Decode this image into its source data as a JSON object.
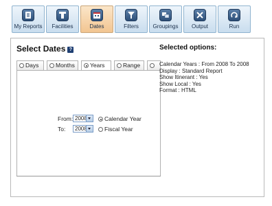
{
  "toolbar": {
    "items": [
      {
        "label": "My Reports",
        "icon": "reports-icon"
      },
      {
        "label": "Facilities",
        "icon": "facilities-icon"
      },
      {
        "label": "Dates",
        "icon": "calendar-icon"
      },
      {
        "label": "Filters",
        "icon": "filter-icon"
      },
      {
        "label": "Groupings",
        "icon": "groupings-icon"
      },
      {
        "label": "Output",
        "icon": "tools-icon"
      },
      {
        "label": "Run",
        "icon": "run-icon"
      }
    ],
    "active": "Dates"
  },
  "panel": {
    "title": "Select Dates",
    "help_icon_text": "?"
  },
  "tabs": [
    {
      "label": "Days",
      "selected": false
    },
    {
      "label": "Months",
      "selected": false
    },
    {
      "label": "Years",
      "selected": true
    },
    {
      "label": "Range",
      "selected": false
    },
    {
      "label": "",
      "selected": false
    }
  ],
  "date_form": {
    "from_label": "From:",
    "to_label": "To:",
    "from_value": "2008",
    "to_value": "2008",
    "calendar_year_label": "Calendar Year",
    "fiscal_year_label": "Fiscal Year",
    "year_type_selected": "Calendar Year"
  },
  "selected_options": {
    "heading": "Selected options:",
    "lines": [
      "Calendar Years : From 2008 To 2008",
      "Display : Standard Report",
      "Show Itinerant : Yes",
      "Show Local : Yes",
      "Format : HTML"
    ]
  },
  "colors": {
    "toolbar_button": "#c9ddee",
    "toolbar_active": "#f2c591",
    "help_icon": "#1f3f73"
  }
}
